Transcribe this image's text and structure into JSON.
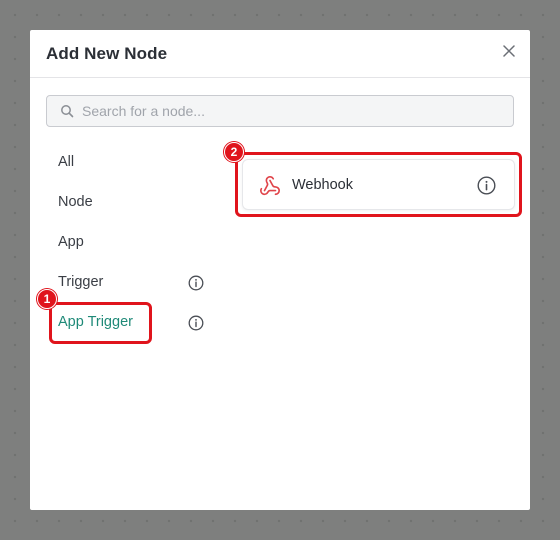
{
  "modal": {
    "title": "Add New Node",
    "close_icon": "close-icon"
  },
  "search": {
    "placeholder": "Search for a node...",
    "value": "",
    "icon": "search-icon"
  },
  "categories": [
    {
      "label": "All",
      "active": false,
      "info": false
    },
    {
      "label": "Node",
      "active": false,
      "info": false
    },
    {
      "label": "App",
      "active": false,
      "info": false
    },
    {
      "label": "Trigger",
      "active": false,
      "info": true
    },
    {
      "label": "App Trigger",
      "active": true,
      "info": true
    }
  ],
  "nodes": [
    {
      "label": "Webhook",
      "icon": "webhook-icon",
      "info_icon": "info-icon"
    }
  ],
  "annotations": [
    {
      "number": "1",
      "target": "App Trigger"
    },
    {
      "number": "2",
      "target": "Webhook"
    }
  ],
  "colors": {
    "accent": "#1f8a78",
    "highlight": "#e0141c",
    "webhook_icon": "#e0444a",
    "overlay": "#7e7f7e"
  }
}
